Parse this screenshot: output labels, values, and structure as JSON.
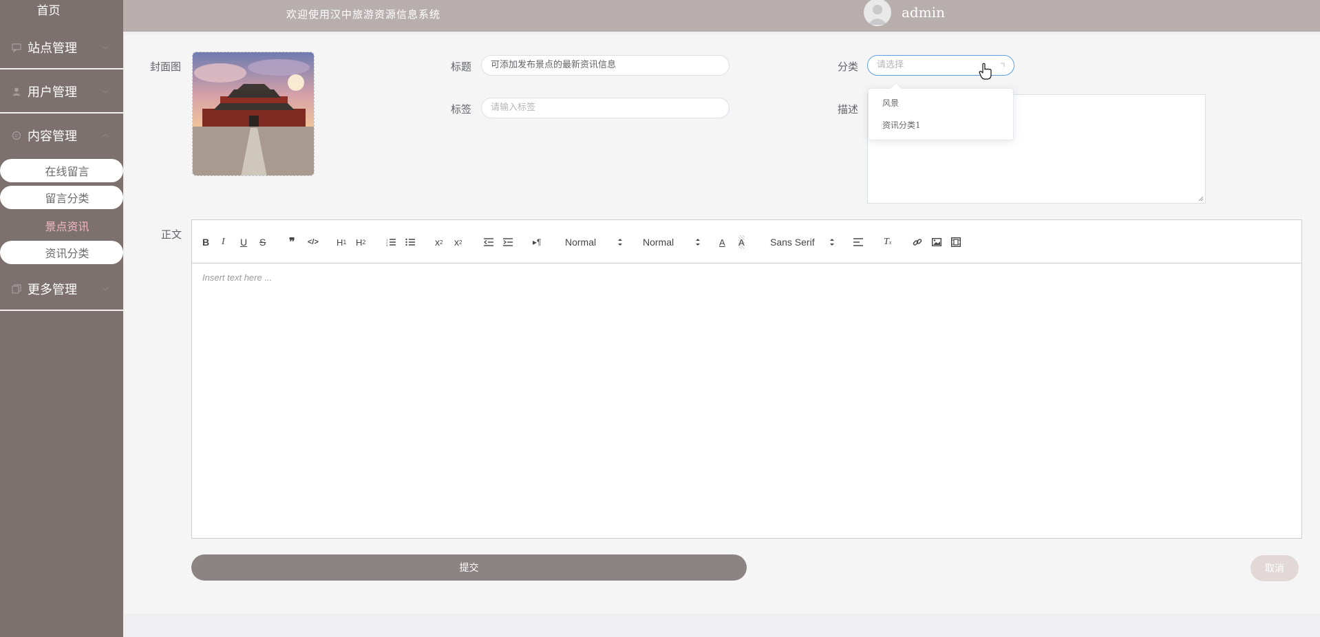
{
  "sidebar": {
    "home": "首页",
    "groups": [
      {
        "label": "站点管理",
        "icon": "chat-icon"
      },
      {
        "label": "用户管理",
        "icon": "user-icon"
      },
      {
        "label": "内容管理",
        "icon": "message-icon"
      },
      {
        "label": "更多管理",
        "icon": "copy-icon"
      }
    ],
    "content_sub": [
      {
        "label": "在线留言"
      },
      {
        "label": "留言分类"
      },
      {
        "label": "景点资讯",
        "active": true
      },
      {
        "label": "资讯分类"
      }
    ]
  },
  "header": {
    "welcome": "欢迎使用汉中旅游资源信息系统",
    "username": "admin"
  },
  "form": {
    "cover_label": "封面图",
    "title_label": "标题",
    "title_value": "可添加发布景点的最新资讯信息",
    "tag_label": "标签",
    "tag_placeholder": "请输入标签",
    "category_label": "分类",
    "category_placeholder": "请选择",
    "category_options": [
      "风景",
      "资讯分类1"
    ],
    "desc_label": "描述",
    "body_label": "正文",
    "body_placeholder": "Insert text here ...",
    "submit": "提交",
    "cancel": "取消"
  },
  "editor_toolbar": {
    "header_picker": "Normal",
    "size_picker": "Normal",
    "font_picker": "Sans Serif"
  },
  "colors": {
    "sidebar_bg": "#7d7170",
    "topbar_bg": "#b8aeae",
    "active_sub": "#f3b7c6",
    "submit_bg": "#8c8484",
    "cancel_bg": "#e2d8d8",
    "select_border": "#5aa0e0"
  }
}
